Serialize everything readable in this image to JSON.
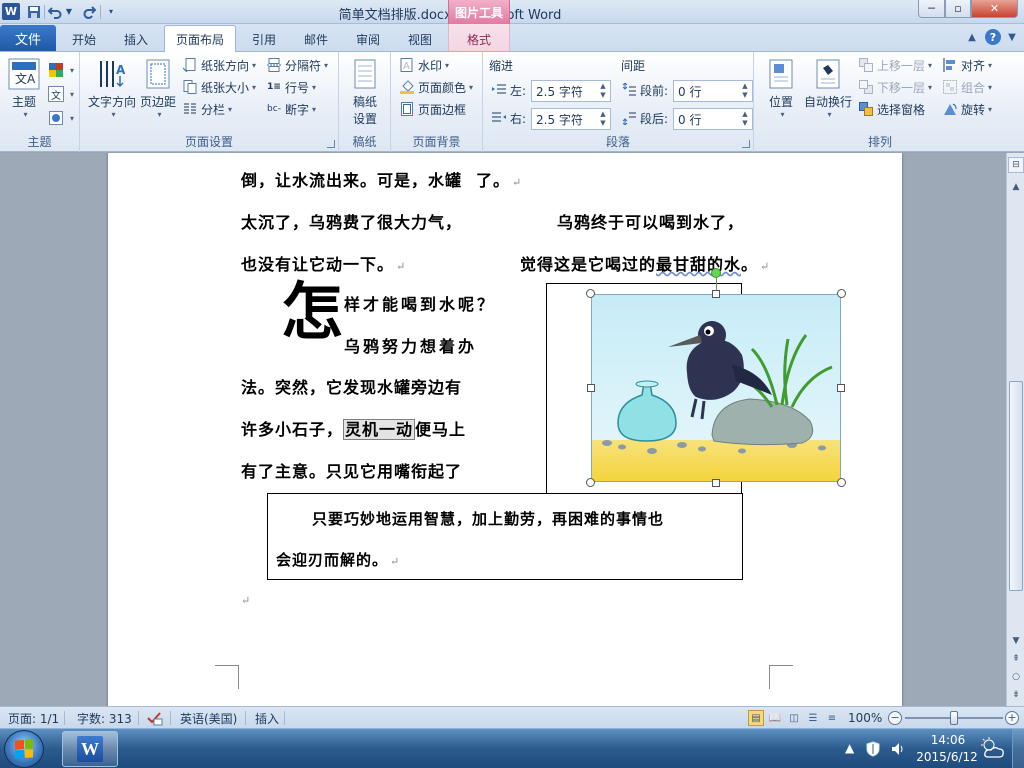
{
  "app": {
    "logo_letter": "W",
    "document_title": "简单文档排版.docx - Microsoft Word",
    "context_tools_label": "图片工具",
    "window_buttons": {
      "minimize": "─",
      "maximize": "▫",
      "close": "✕"
    }
  },
  "quick_access": {
    "save_icon": "save-icon",
    "undo_icon": "undo-icon",
    "redo_icon": "redo-icon"
  },
  "tabs": {
    "file": "文件",
    "items": [
      "开始",
      "插入",
      "页面布局",
      "引用",
      "邮件",
      "审阅",
      "视图",
      "格式"
    ],
    "active": "页面布局",
    "help": "?"
  },
  "ribbon": {
    "theme": {
      "label": "主题",
      "theme_button": "主题",
      "colors_icon": "theme-colors-icon",
      "fonts_icon": "theme-fonts-icon",
      "effects_icon": "theme-effects-icon"
    },
    "page_setup": {
      "label": "页面设置",
      "text_direction": "文字方向",
      "margins": "页边距",
      "orientation": "纸张方向",
      "size": "纸张大小",
      "columns": "分栏",
      "breaks": "分隔符",
      "line_numbers": "行号",
      "hyphenation": "断字"
    },
    "draft": {
      "label": "稿纸",
      "button_line1": "稿纸",
      "button_line2": "设置"
    },
    "page_background": {
      "label": "页面背景",
      "watermark": "水印",
      "page_color": "页面颜色",
      "page_borders": "页面边框"
    },
    "paragraph": {
      "label": "段落",
      "indent_title": "缩进",
      "spacing_title": "间距",
      "left_label": "左:",
      "left_value": "2.5 字符",
      "right_label": "右:",
      "right_value": "2.5 字符",
      "before_label": "段前:",
      "before_value": "0 行",
      "after_label": "段后:",
      "after_value": "0 行"
    },
    "arrange": {
      "label": "排列",
      "position": "位置",
      "wrap_text": "自动换行",
      "bring_forward": "上移一层",
      "send_backward": "下移一层",
      "selection_pane": "选择窗格",
      "align": "对齐",
      "group": "组合",
      "rotate": "旋转"
    }
  },
  "document": {
    "left_lines": [
      "倒，让水流出来。可是，水罐",
      "太沉了，乌鸦费了很大力气，",
      "也没有让它动一下。"
    ],
    "line1_tail": "了。",
    "right_col_line1": "乌鸦终于可以喝到水了，",
    "right_col_line2_pre": "觉得这是它喝过的",
    "right_col_line2_wavy": "最甘甜的水",
    "right_col_line2_post": "。",
    "dropcap": "怎",
    "dropcap_line1": "样才能喝到水呢？",
    "dropcap_line2": "乌鸦努力想着办",
    "para_line3": "法。突然，它发现水罐旁边有",
    "para_line4_pre": "许多小石子，",
    "para_line4_hl": "灵机一动",
    "para_line4_post": "便马上",
    "para_line5": "有了主意。只见它用嘴衔起了",
    "textbox_line1": "只要巧妙地运用智慧，加上勤劳，再困难的事情也",
    "textbox_line2": "会迎刃而解的。",
    "paragraph_mark": "↵",
    "image_name": "crow-pitcher-image"
  },
  "status": {
    "page": "页面: 1/1",
    "words": "字数: 313",
    "language": "英语(美国)",
    "mode": "插入",
    "zoom": "100%",
    "zoom_level": 1.0
  },
  "taskbar": {
    "time": "14:06",
    "date": "2015/6/12"
  },
  "colors": {
    "word_blue": "#2b579a",
    "context_pink": "#e27aa2",
    "file_tab": "#1f5aa8"
  }
}
